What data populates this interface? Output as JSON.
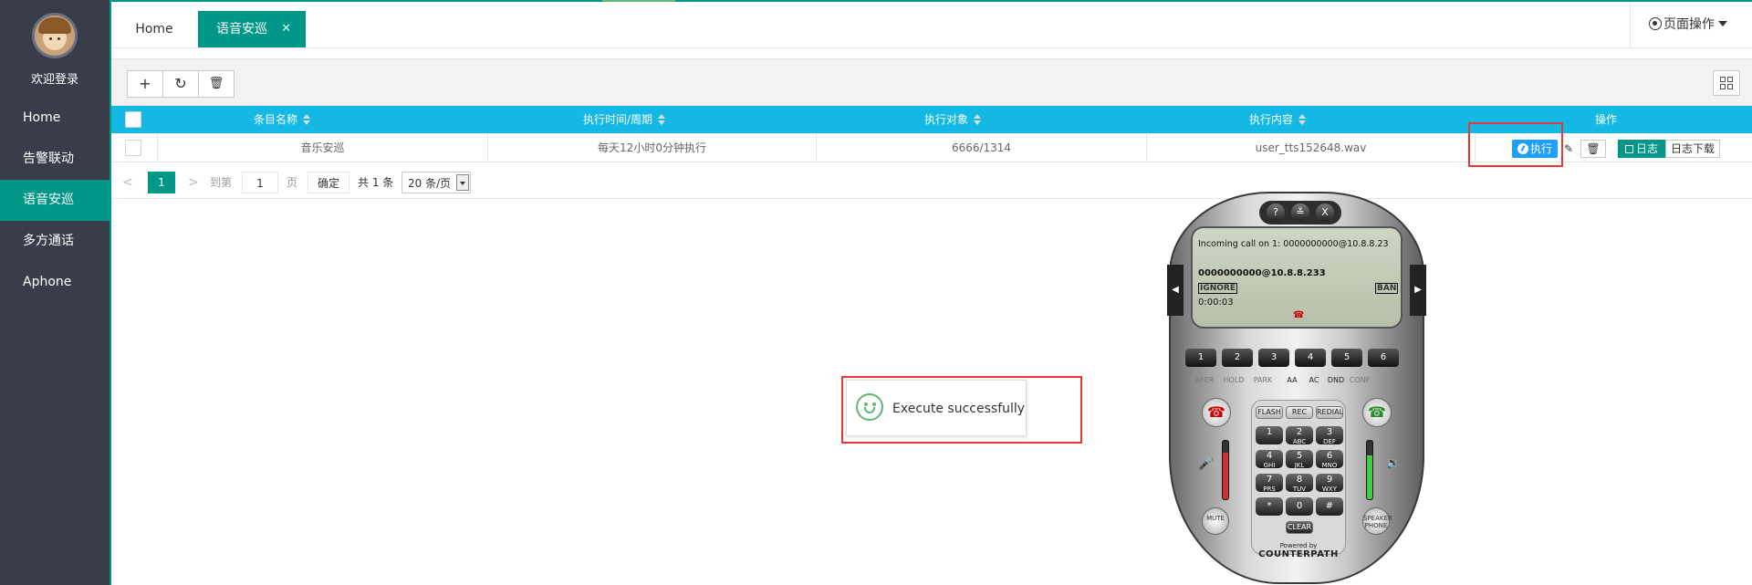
{
  "sidebar": {
    "welcome": "欢迎登录",
    "items": [
      {
        "label": "Home",
        "active": false
      },
      {
        "label": "告警联动",
        "active": false
      },
      {
        "label": "语音安巡",
        "active": true
      },
      {
        "label": "多方通话",
        "active": false
      },
      {
        "label": "Aphone",
        "active": false
      }
    ]
  },
  "header": {
    "tabs": [
      {
        "label": "Home"
      },
      {
        "label": "语音安巡",
        "close": "✕"
      }
    ],
    "page_ops": "页面操作"
  },
  "toolbar": {
    "add_icon": "+",
    "refresh_icon": "↻",
    "delete_icon": "🗑"
  },
  "table": {
    "columns": [
      "条目名称",
      "执行时间/周期",
      "执行对象",
      "执行内容",
      "操作"
    ],
    "rows": [
      {
        "name": "音乐安巡",
        "schedule": "每天12小时0分钟执行",
        "target": "6666/1314",
        "content": "user_tts152648.wav"
      }
    ],
    "actions": {
      "execute": "执行",
      "edit_icon": "✎",
      "delete_icon": "🗑",
      "log": "日志",
      "log_download": "日志下载"
    }
  },
  "pagination": {
    "prev": "<",
    "current": "1",
    "next": ">",
    "goto_label": "到第",
    "goto_value": "1",
    "page_unit": "页",
    "confirm": "确定",
    "total": "共 1 条",
    "page_size": "20 条/页"
  },
  "toast": {
    "message": "Execute successfully"
  },
  "softphone": {
    "top_buttons": [
      "?",
      "≚",
      "X"
    ],
    "screen": {
      "incoming": "Incoming call on 1: 0000000000@10.8.8.23",
      "caller": "0000000000@10.8.8.233",
      "ignore": "IGNORE",
      "ban": "BAN",
      "timer": "0:00:03"
    },
    "lines": [
      "1",
      "2",
      "3",
      "4",
      "5",
      "6"
    ],
    "functions": [
      "XFER",
      "HOLD",
      "PARK",
      "AA",
      "AC",
      "DND",
      "CONF"
    ],
    "softkeys": [
      "FLASH",
      "REC",
      "REDIAL"
    ],
    "keys": [
      {
        "d": "1",
        "l": ""
      },
      {
        "d": "2",
        "l": "ABC"
      },
      {
        "d": "3",
        "l": "DEF"
      },
      {
        "d": "4",
        "l": "GHI"
      },
      {
        "d": "5",
        "l": "JKL"
      },
      {
        "d": "6",
        "l": "MNO"
      },
      {
        "d": "7",
        "l": "PRS"
      },
      {
        "d": "8",
        "l": "TUV"
      },
      {
        "d": "9",
        "l": "WXY"
      },
      {
        "d": "*",
        "l": ""
      },
      {
        "d": "0",
        "l": ""
      },
      {
        "d": "#",
        "l": ""
      }
    ],
    "clear": "CLEAR",
    "mute": "MUTE",
    "speaker": "SPEAKER PHONE",
    "powered_by": "Powered by",
    "brand": "COUNTERPATH"
  },
  "colors": {
    "sidebar_bg": "#393d49",
    "accent": "#009688",
    "table_header": "#13b9e4",
    "execute_btn": "#1e9fff",
    "highlight": "#e53935",
    "success": "#5fb878"
  }
}
